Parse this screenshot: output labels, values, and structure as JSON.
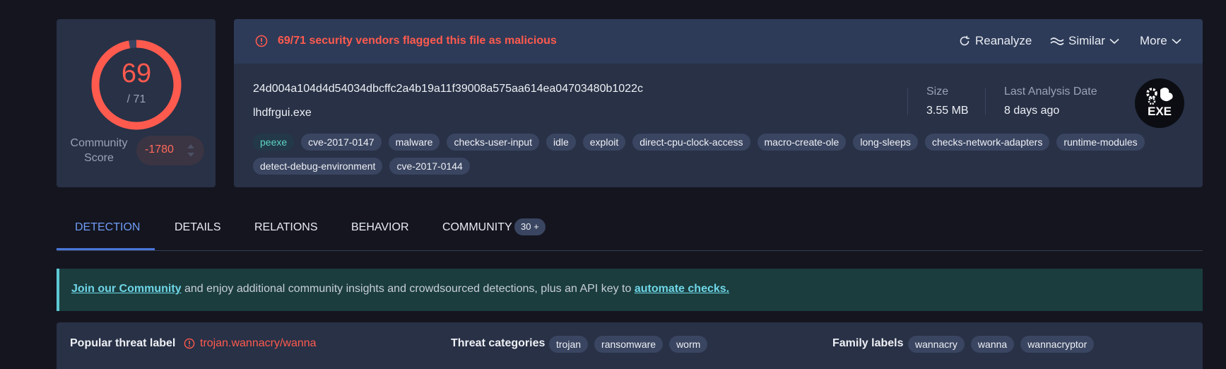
{
  "score": {
    "detected": "69",
    "total": "/ 71",
    "ratio": 0.9718
  },
  "community": {
    "label": "Community Score",
    "value": "-1780"
  },
  "alert": {
    "text": "69/71 security vendors flagged this file as malicious"
  },
  "actions": {
    "reanalyze": "Reanalyze",
    "similar": "Similar",
    "more": "More"
  },
  "file": {
    "hash": "24d004a104d4d54034dbcffc2a4b19a11f39008a575aa614ea04703480b1022c",
    "name": "lhdfrgui.exe",
    "size_label": "Size",
    "size_value": "3.55 MB",
    "date_label": "Last Analysis Date",
    "date_value": "8 days ago",
    "type_icon": "EXE"
  },
  "tags": [
    "peexe",
    "cve-2017-0147",
    "malware",
    "checks-user-input",
    "idle",
    "exploit",
    "direct-cpu-clock-access",
    "macro-create-ole",
    "long-sleeps",
    "checks-network-adapters",
    "runtime-modules",
    "detect-debug-environment",
    "cve-2017-0144"
  ],
  "tabs": [
    {
      "label": "DETECTION",
      "active": true
    },
    {
      "label": "DETAILS",
      "active": false
    },
    {
      "label": "RELATIONS",
      "active": false
    },
    {
      "label": "BEHAVIOR",
      "active": false
    },
    {
      "label": "COMMUNITY",
      "active": false,
      "badge": "30 +"
    }
  ],
  "banner": {
    "link1": "Join our Community",
    "middle": " and enjoy additional community insights and crowdsourced detections, plus an API key to ",
    "link2": "automate checks."
  },
  "threat": {
    "popular_label": "Popular threat label",
    "popular_value": "trojan.wannacry/wanna",
    "categories_label": "Threat categories",
    "categories": [
      "trojan",
      "ransomware",
      "worm"
    ],
    "family_label": "Family labels",
    "families": [
      "wannacry",
      "wanna",
      "wannacryptor"
    ]
  },
  "colors": {
    "danger": "#ff5a4e",
    "accent": "#4a76d8",
    "card": "#283146",
    "background": "#14151f"
  },
  "icons": [
    "alert-circle-icon",
    "reanalyze-icon",
    "similar-icon",
    "chevron-down-icon",
    "exe-file-icon"
  ]
}
